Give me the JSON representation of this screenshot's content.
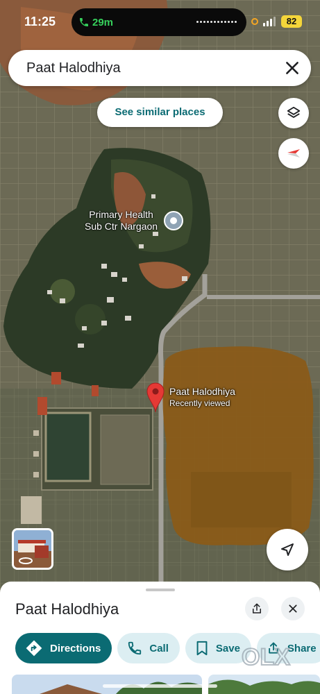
{
  "status_bar": {
    "time": "11:25",
    "call_duration": "29m",
    "battery": "82"
  },
  "search": {
    "query": "Paat Halodhiya",
    "clear_icon": "close-icon"
  },
  "map": {
    "similar_places_label": "See similar places",
    "layers_icon": "layers-icon",
    "compass_icon": "compass-icon",
    "poi": {
      "name_line1": "Primary Health",
      "name_line2": "Sub Ctr Nargaon"
    },
    "pin": {
      "name": "Paat Halodhiya",
      "subtitle": "Recently viewed"
    },
    "location_icon": "navigation-arrow-icon"
  },
  "sheet": {
    "title": "Paat Halodhiya",
    "share_icon": "share-icon",
    "close_icon": "close-icon",
    "actions": [
      {
        "label": "Directions",
        "icon": "directions-icon"
      },
      {
        "label": "Call",
        "icon": "phone-icon"
      },
      {
        "label": "Save",
        "icon": "bookmark-icon"
      },
      {
        "label": "Share",
        "icon": "share-icon"
      }
    ]
  },
  "watermark": "OLX",
  "colors": {
    "accent": "#0b6b73",
    "action_bg": "#dceef2",
    "pin_red": "#e53935",
    "battery": "#f4d53a",
    "call_green": "#36d05c"
  }
}
